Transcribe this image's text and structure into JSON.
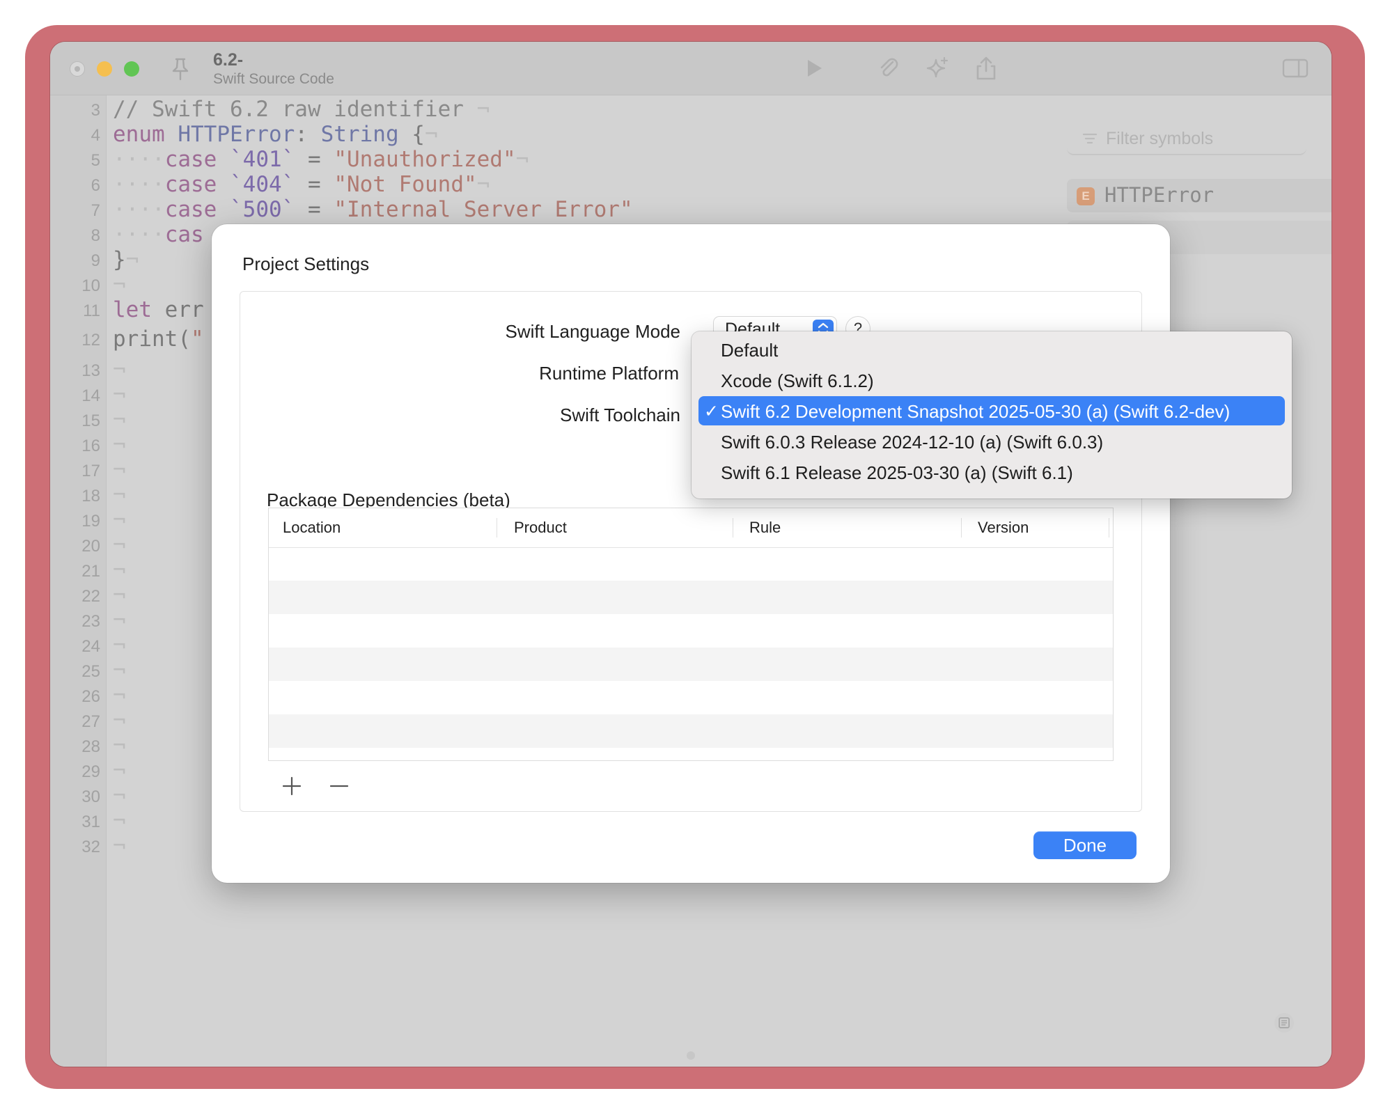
{
  "window": {
    "doc_title": "6.2-",
    "doc_subtitle": "Swift Source Code"
  },
  "editor": {
    "lines": [
      {
        "n": "3",
        "text": "// Swift 6.2 raw identifier ¬"
      },
      {
        "n": "4",
        "text": "enum HTTPError: String {¬"
      },
      {
        "n": "5",
        "text": "····case `401` = \"Unauthorized\"¬"
      },
      {
        "n": "6",
        "text": "····case `404` = \"Not Found\"¬"
      },
      {
        "n": "7",
        "text": "····case `500` = \"Internal Server Error\""
      },
      {
        "n": "8",
        "text": "····cas"
      },
      {
        "n": "9",
        "text": "}¬"
      },
      {
        "n": "10",
        "text": "¬"
      },
      {
        "n": "11",
        "text": "let err"
      },
      {
        "n": "12",
        "text": "print(\""
      },
      {
        "n": "13",
        "text": "¬"
      },
      {
        "n": "14",
        "text": "¬"
      },
      {
        "n": "15",
        "text": "¬"
      },
      {
        "n": "16",
        "text": "¬"
      },
      {
        "n": "17",
        "text": "¬"
      },
      {
        "n": "18",
        "text": "¬"
      },
      {
        "n": "19",
        "text": "¬"
      },
      {
        "n": "20",
        "text": "¬"
      },
      {
        "n": "21",
        "text": "¬"
      },
      {
        "n": "22",
        "text": "¬"
      },
      {
        "n": "23",
        "text": "¬"
      },
      {
        "n": "24",
        "text": "¬"
      },
      {
        "n": "25",
        "text": "¬"
      },
      {
        "n": "26",
        "text": "¬"
      },
      {
        "n": "27",
        "text": "¬"
      },
      {
        "n": "28",
        "text": "¬"
      },
      {
        "n": "29",
        "text": "¬"
      },
      {
        "n": "30",
        "text": "¬"
      },
      {
        "n": "31",
        "text": "¬"
      },
      {
        "n": "32",
        "text": "¬"
      }
    ]
  },
  "sidebar": {
    "filter_placeholder": "Filter symbols",
    "symbol_badge": "E",
    "symbol_name": "HTTPError"
  },
  "modal": {
    "title": "Project Settings",
    "fields": {
      "language_mode_label": "Swift Language Mode",
      "language_mode_value": "Default",
      "help_label": "?",
      "runtime_label": "Runtime Platform",
      "toolchain_label": "Swift Toolchain"
    },
    "dependencies": {
      "title": "Package Dependencies (beta)",
      "columns": [
        "Location",
        "Product",
        "Rule",
        "Version"
      ]
    },
    "done_label": "Done"
  },
  "dropdown": {
    "items": [
      {
        "label": "Default",
        "selected": false
      },
      {
        "label": "Xcode (Swift 6.1.2)",
        "selected": false
      },
      {
        "label": "Swift 6.2 Development Snapshot 2025-05-30 (a) (Swift 6.2-dev)",
        "selected": true
      },
      {
        "label": "Swift 6.0.3 Release 2024-12-10 (a) (Swift 6.0.3)",
        "selected": false
      },
      {
        "label": "Swift 6.1 Release 2025-03-30 (a) (Swift 6.1)",
        "selected": false
      }
    ],
    "check_glyph": "✓"
  },
  "colors": {
    "frame": "#cd6f76",
    "accent": "#3b82f6"
  }
}
